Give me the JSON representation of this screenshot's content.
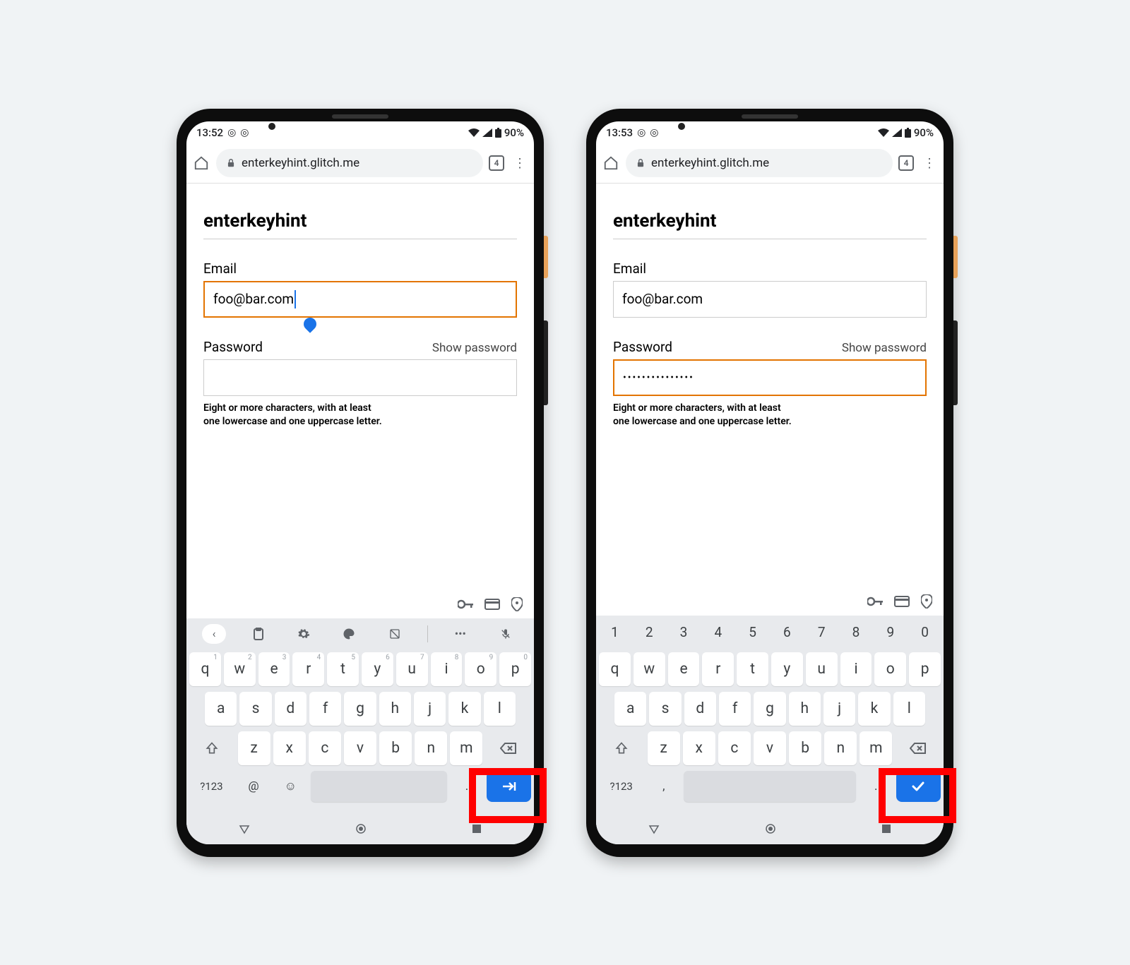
{
  "phones": [
    {
      "status": {
        "time": "13:52",
        "battery": "90%"
      },
      "chrome": {
        "tabs": "4",
        "url": "enterkeyhint.glitch.me"
      },
      "page": {
        "heading": "enterkeyhint",
        "email_label": "Email",
        "email_value": "foo@bar.com",
        "email_focused": true,
        "password_label": "Password",
        "show_password": "Show password",
        "password_value": "",
        "password_focused": false,
        "hint_line1": "Eight or more characters, with at least",
        "hint_line2": "one lowercase and one uppercase letter."
      },
      "enter_key_type": "next",
      "keyboard_variant": "alpha"
    },
    {
      "status": {
        "time": "13:53",
        "battery": "90%"
      },
      "chrome": {
        "tabs": "4",
        "url": "enterkeyhint.glitch.me"
      },
      "page": {
        "heading": "enterkeyhint",
        "email_label": "Email",
        "email_value": "foo@bar.com",
        "email_focused": false,
        "password_label": "Password",
        "show_password": "Show password",
        "password_value": "•••••••••••••••",
        "password_focused": true,
        "hint_line1": "Eight or more characters, with at least",
        "hint_line2": "one lowercase and one uppercase letter."
      },
      "enter_key_type": "done",
      "keyboard_variant": "numeric-top"
    }
  ],
  "keyboard": {
    "numbers": [
      "1",
      "2",
      "3",
      "4",
      "5",
      "6",
      "7",
      "8",
      "9",
      "0"
    ],
    "row1": [
      "q",
      "w",
      "e",
      "r",
      "t",
      "y",
      "u",
      "i",
      "o",
      "p"
    ],
    "row1_sup": [
      "1",
      "2",
      "3",
      "4",
      "5",
      "6",
      "7",
      "8",
      "9",
      "0"
    ],
    "row2": [
      "a",
      "s",
      "d",
      "f",
      "g",
      "h",
      "j",
      "k",
      "l"
    ],
    "row3": [
      "z",
      "x",
      "c",
      "v",
      "b",
      "n",
      "m"
    ],
    "sym_key": "?123",
    "at_key": "@",
    "dot_key": ".",
    "comma_key": ","
  }
}
